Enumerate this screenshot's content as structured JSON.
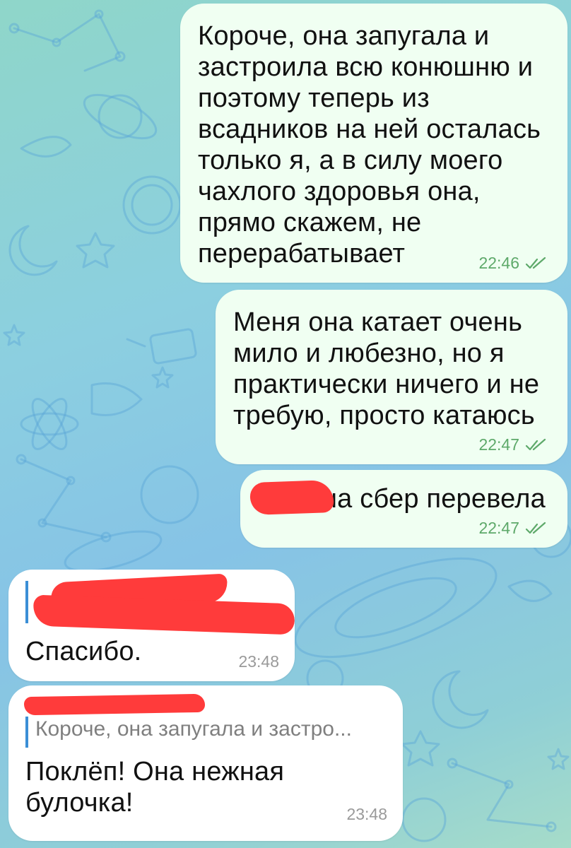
{
  "colors": {
    "outgoing_bubble": "#f0fff2",
    "incoming_bubble": "#ffffff",
    "outgoing_time": "#5ea96a",
    "incoming_time": "#9a9a9a",
    "reply_bar": "#3b8fd6",
    "redaction": "#ff3b3b"
  },
  "messages": [
    {
      "direction": "outgoing",
      "lines": [
        "Короче, она запугала и",
        "застроила всю конюшню и",
        "поэтому теперь из",
        "всадников на ней осталась",
        "только я, а в силу моего",
        "чахлого здоровья она,",
        "прямо скажем, не",
        "перерабатывает"
      ],
      "time": "22:46",
      "status_icon": "double-check-icon"
    },
    {
      "direction": "outgoing",
      "lines": [
        "Меня она катает очень",
        "мило и любезно, но я",
        "практически ничего и не",
        "требую, просто катаюсь"
      ],
      "time": "22:47",
      "status_icon": "double-check-icon"
    },
    {
      "direction": "outgoing",
      "lines": [
        "на сбер перевела"
      ],
      "time": "22:47",
      "status_icon": "double-check-icon"
    },
    {
      "direction": "incoming",
      "lines": [
        "Спасибо."
      ],
      "time": "23:48"
    },
    {
      "direction": "incoming",
      "reply_preview": "Короче, она запугала и застро...",
      "lines": [
        "Поклёп! Она нежная",
        "булочка!"
      ],
      "time": "23:48"
    }
  ]
}
